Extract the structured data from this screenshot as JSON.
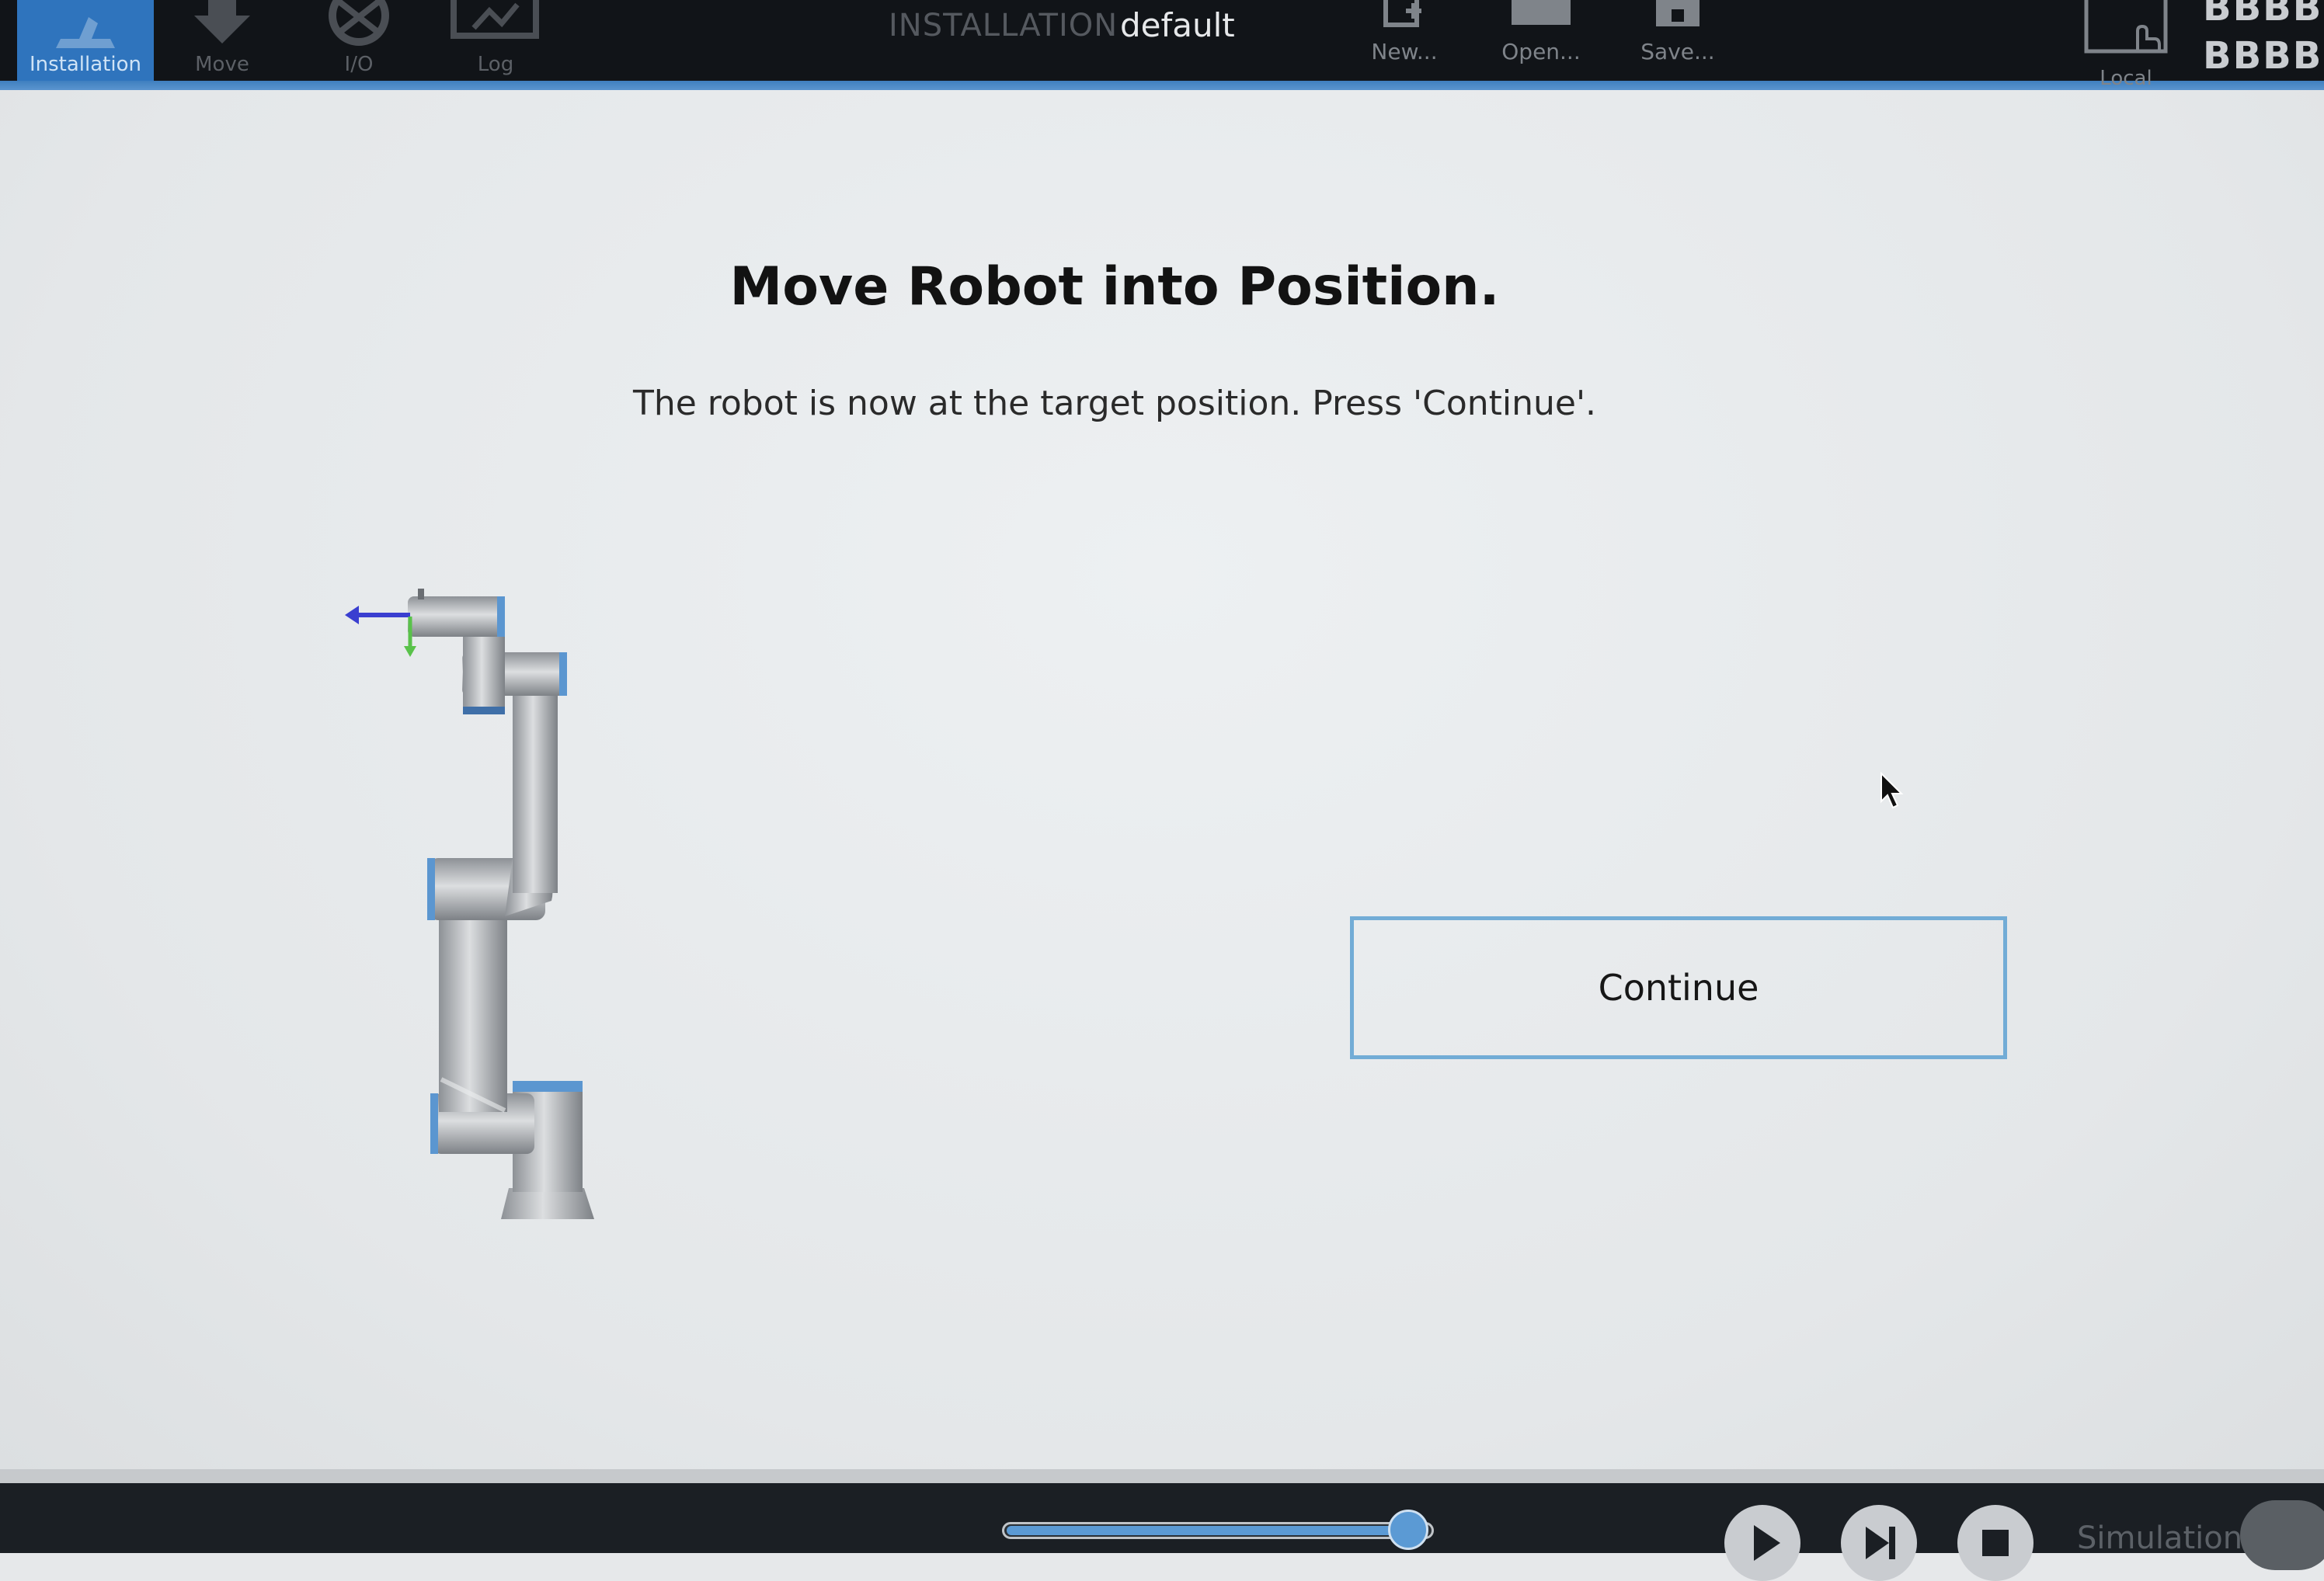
{
  "nav": {
    "tabs": [
      {
        "label": "Installation",
        "icon": "installation-icon",
        "active": true
      },
      {
        "label": "Move",
        "icon": "move-icon",
        "active": false
      },
      {
        "label": "I/O",
        "icon": "io-icon",
        "active": false
      },
      {
        "label": "Log",
        "icon": "log-icon",
        "active": false
      }
    ]
  },
  "header": {
    "section_label": "INSTALLATION",
    "installation_name": "default",
    "file_buttons": [
      {
        "label": "New...",
        "icon": "new-file-icon"
      },
      {
        "label": "Open...",
        "icon": "open-folder-icon"
      },
      {
        "label": "Save...",
        "icon": "save-icon"
      }
    ],
    "local_label": "Local",
    "status_top": "BBBB",
    "status_bottom": "BBBB"
  },
  "dialog": {
    "title": "Move Robot into Position.",
    "message": "The robot is now at the target position. Press 'Continue'.",
    "continue_label": "Continue"
  },
  "footer": {
    "speed_slider_fraction": 0.95,
    "play_icon": "play-icon",
    "step_icon": "step-icon",
    "stop_icon": "stop-icon",
    "simulation_label": "Simulation"
  },
  "colors": {
    "accent": "#2f74bd",
    "topbar": "#111418",
    "continue_border": "#72acd6",
    "axis_x": "#3a3fd0",
    "axis_z": "#59c24a"
  }
}
